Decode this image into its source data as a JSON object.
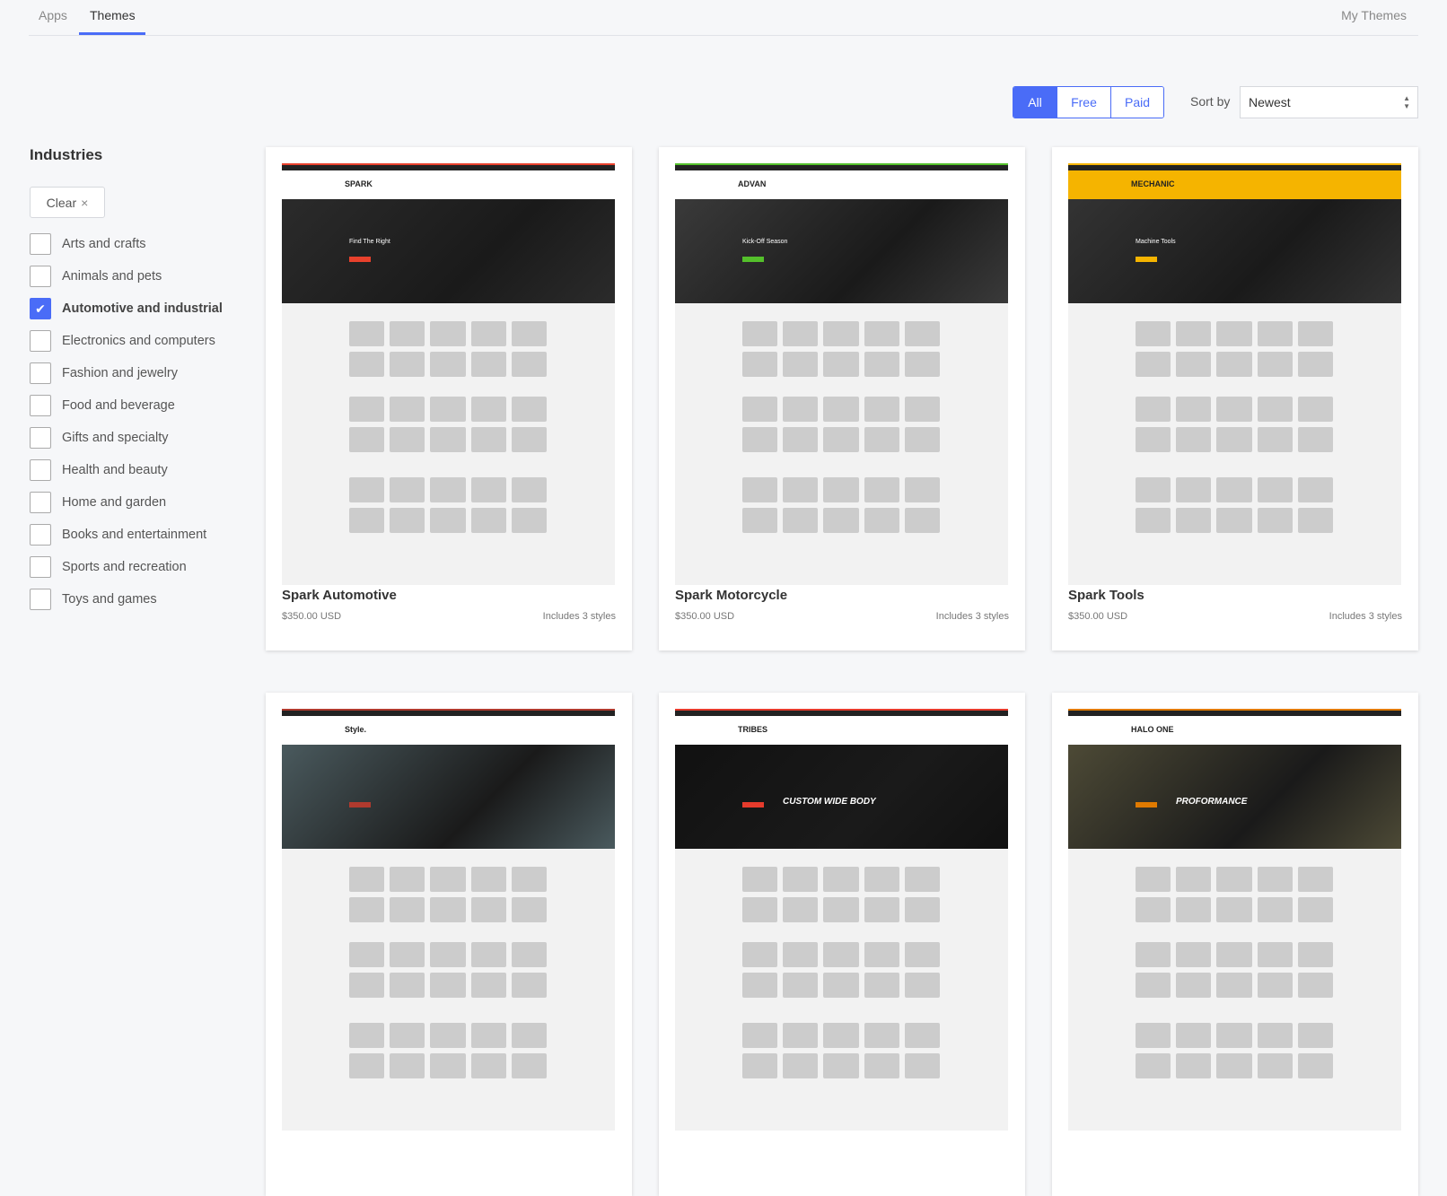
{
  "tabs": [
    {
      "label": "Apps",
      "active": false
    },
    {
      "label": "Themes",
      "active": true
    }
  ],
  "my_themes": "My Themes",
  "filter": {
    "options": [
      "All",
      "Free",
      "Paid"
    ],
    "selected": "All"
  },
  "sort": {
    "label": "Sort by",
    "value": "Newest"
  },
  "sidebar": {
    "title": "Industries",
    "clear": "Clear",
    "clear_icon": "close-icon",
    "items": [
      {
        "label": "Arts and crafts",
        "checked": false
      },
      {
        "label": "Animals and pets",
        "checked": false
      },
      {
        "label": "Automotive and industrial",
        "checked": true
      },
      {
        "label": "Electronics and computers",
        "checked": false
      },
      {
        "label": "Fashion and jewelry",
        "checked": false
      },
      {
        "label": "Food and beverage",
        "checked": false
      },
      {
        "label": "Gifts and specialty",
        "checked": false
      },
      {
        "label": "Health and beauty",
        "checked": false
      },
      {
        "label": "Home and garden",
        "checked": false
      },
      {
        "label": "Books and entertainment",
        "checked": false
      },
      {
        "label": "Sports and recreation",
        "checked": false
      },
      {
        "label": "Toys and games",
        "checked": false
      }
    ]
  },
  "themes": [
    {
      "name": "Spark Automotive",
      "price": "$350.00 USD",
      "styles": "Includes 3 styles",
      "logo": "SPARK",
      "hero": "Find The Right",
      "accent": "#e8412c",
      "hero_color": "#2b2b2b"
    },
    {
      "name": "Spark Motorcycle",
      "price": "$350.00 USD",
      "styles": "Includes 3 styles",
      "logo": "ADVAN",
      "hero": "Kick-Off Season",
      "accent": "#54c02b",
      "hero_color": "#3a3a3a"
    },
    {
      "name": "Spark Tools",
      "price": "$350.00 USD",
      "styles": "Includes 3 styles",
      "logo": "MECHANIC",
      "hero": "Machine Tools",
      "accent": "#f5b400",
      "hero_color": "#333333"
    },
    {
      "logo": "Style.",
      "hero": "",
      "accent": "#b03a2e",
      "hero_color": "#4a5a5e"
    },
    {
      "logo": "TRIBES",
      "hero": "CUSTOM WIDE BODY",
      "accent": "#e53b2c",
      "hero_color": "#111111"
    },
    {
      "logo": "HALO ONE",
      "hero": "PROFORMANCE",
      "accent": "#e07a00",
      "hero_color": "#4d4a36"
    }
  ],
  "colors": {
    "accent": "#4a6cf7",
    "background": "#f6f7f9"
  }
}
